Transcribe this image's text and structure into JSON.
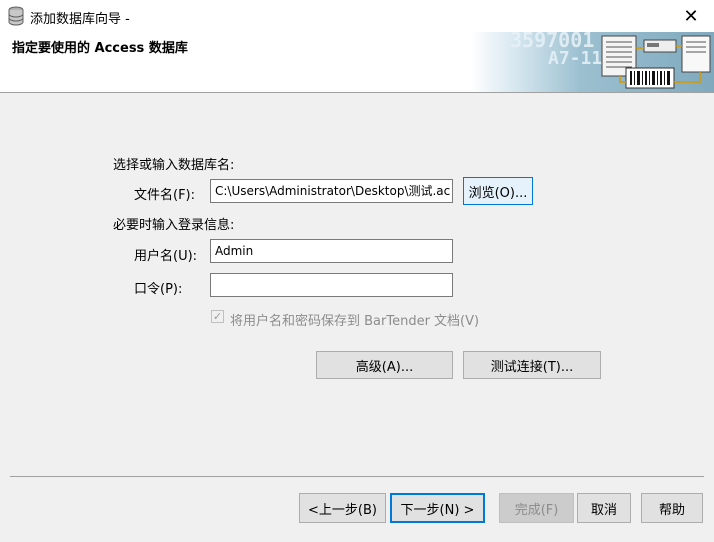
{
  "window": {
    "title": "添加数据库向导 -",
    "close_symbol": "✕"
  },
  "header": {
    "title": "指定要使用的 Access 数据库",
    "banner_text_1": "3597001",
    "banner_text_2": "A7-118"
  },
  "form": {
    "section_database": "选择或输入数据库名:",
    "file_label": "文件名(F):",
    "file_value": "C:\\Users\\Administrator\\Desktop\\测试.ac",
    "browse_label": "浏览(O)...",
    "section_login": "必要时输入登录信息:",
    "user_label": "用户名(U):",
    "user_value": "Admin",
    "password_label": "口令(P):",
    "password_value": "",
    "save_checkbox_label": "将用户名和密码保存到 BarTender 文档(V)",
    "save_checkbox_checked": true,
    "advanced_label": "高级(A)...",
    "test_connection_label": "测试连接(T)..."
  },
  "footer": {
    "back_label": "<上一步(B)",
    "next_label": "下一步(N) >",
    "finish_label": "完成(F)",
    "cancel_label": "取消",
    "help_label": "帮助"
  },
  "icons": {
    "app": "database-icon",
    "close": "close-icon",
    "banner": "barcode-server-illustration"
  },
  "colors": {
    "focus_accent": "#0078d7",
    "dialog_bg": "#f0f0f0",
    "header_bg": "#ffffff"
  }
}
